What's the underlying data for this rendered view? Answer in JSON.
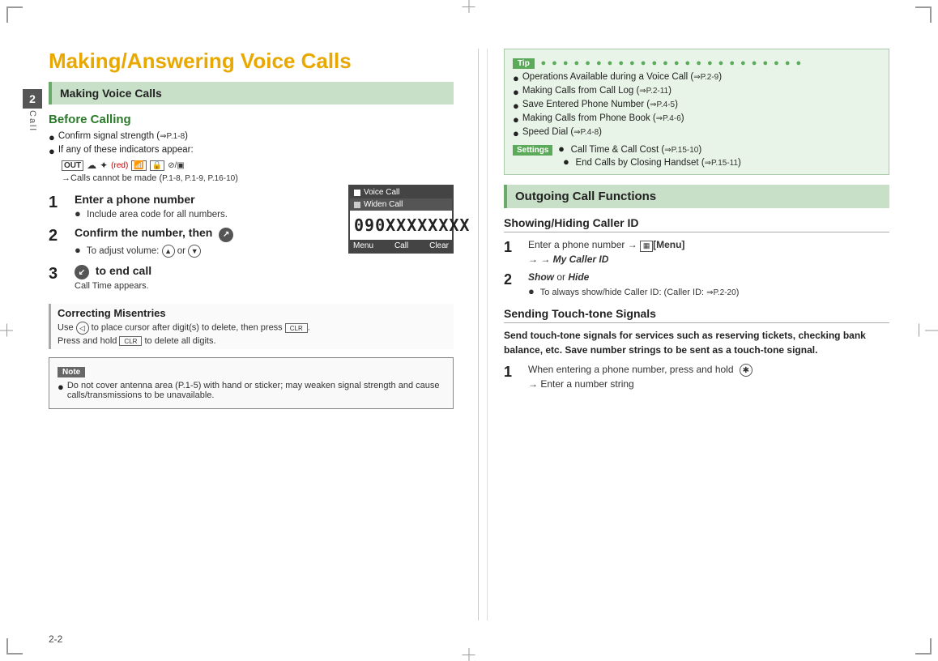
{
  "page": {
    "title": "Making/Answering Voice Calls",
    "page_number": "2-2",
    "chapter_num": "2",
    "chapter_label": "Call"
  },
  "left_col": {
    "section_header": "Making Voice Calls",
    "before_calling": {
      "title": "Before Calling",
      "bullets": [
        "Confirm signal strength (P.1-8)",
        "If any of these indicators appear:"
      ],
      "indicators_note": "(red)",
      "arrow_note": "→Calls cannot be made (P.1-8, P.1-9, P.16-10)"
    },
    "step1": {
      "num": "1",
      "title": "Enter a phone number",
      "detail": "Include area code for all numbers."
    },
    "step2": {
      "num": "2",
      "title": "Confirm the number, then",
      "icon_label": "call-icon",
      "detail": "To adjust volume:"
    },
    "step3": {
      "num": "3",
      "title": "to end call",
      "icon_label": "end-icon",
      "detail": "Call Time appears."
    },
    "phone_display": {
      "title_bar": "Voice Call",
      "menu_row": "Widen Call",
      "number": "090XXXXXXXX",
      "bottom_menu": "Menu",
      "bottom_call": "Call",
      "bottom_clear": "Clear"
    },
    "correcting": {
      "title": "Correcting Misentries",
      "line1": "Use  to place cursor after digit(s) to delete, then press .",
      "line2": "Press and hold  to delete all digits."
    },
    "note": {
      "label": "Note",
      "text": "Do not cover antenna area (P.1-5) with hand or sticker; may weaken signal strength and cause calls/transmissions to be unavailable."
    }
  },
  "right_col": {
    "tip": {
      "label": "Tip",
      "items": [
        "Operations Available during a Voice Call (P.2-9)",
        "Making Calls from Call Log (P.2-11)",
        "Save Entered Phone Number (P.4-5)",
        "Making Calls from Phone Book (P.4-6)",
        "Speed Dial (P.4-8)"
      ],
      "settings_items": [
        "Call Time & Call Cost (P.15-10)",
        "End Calls by Closing Handset (P.15-11)"
      ]
    },
    "outgoing_header": "Outgoing Call Functions",
    "caller_id": {
      "title": "Showing/Hiding Caller ID",
      "step1": {
        "num": "1",
        "text": "Enter a phone number → [Menu]",
        "arrow": "→ My Caller ID"
      },
      "step2": {
        "num": "2",
        "text1": "Show",
        "or": " or ",
        "text2": "Hide",
        "detail": "To always show/hide Caller ID: (Caller ID: P.2-20)"
      }
    },
    "touch_tone": {
      "title": "Sending Touch-tone Signals",
      "description": "Send touch-tone signals for services such as reserving tickets, checking bank balance, etc. Save number strings to be sent as a touch-tone signal.",
      "step1": {
        "num": "1",
        "text": "When entering a phone number, press and hold",
        "icon": "*",
        "arrow": "→ Enter a number string"
      }
    }
  }
}
